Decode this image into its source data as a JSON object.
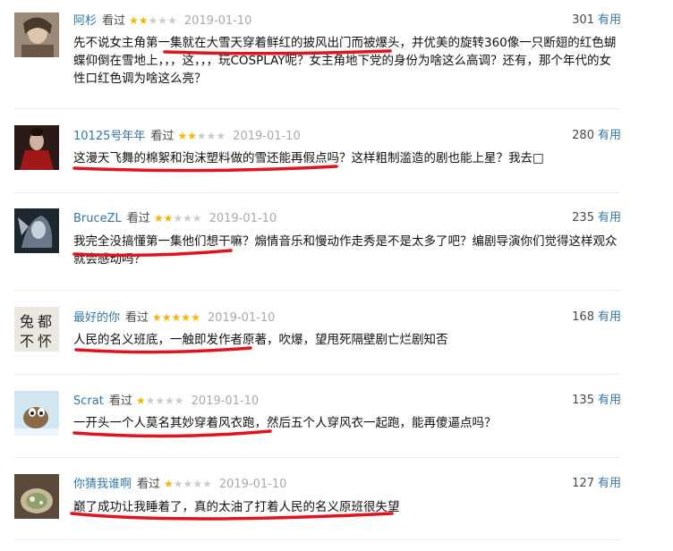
{
  "reviews": [
    {
      "user": "阿杉",
      "status": "看过",
      "rating": 2,
      "date": "2019-01-10",
      "votes": "301",
      "useful": "有用",
      "text": "先不说女主角第一集就在大雪天穿着鲜红的披风出门而被爆头，并优美的旋转360像一只断翅的红色蝴蝶仰倒在雪地上，，，这，，，玩COSPLAY呢？女主角地下党的身份为啥这么高调？还有，那个年代的女性口红色调为啥这么亮？",
      "avatar": {
        "bg": "#8c7a6a",
        "fg": "#d8c2a8",
        "accent": "#3a2e26"
      }
    },
    {
      "user": "10125号年年",
      "status": "看过",
      "rating": 2,
      "date": "2019-01-10",
      "votes": "280",
      "useful": "有用",
      "text": "这漫天飞舞的棉絮和泡沫塑料做的雪还能再假点吗？这样粗制滥造的剧也能上星？我去□",
      "avatar": {
        "bg": "#2b1a16",
        "fg": "#c8a898",
        "accent": "#a01818"
      }
    },
    {
      "user": "BruceZL",
      "status": "看过",
      "rating": 2,
      "date": "2019-01-10",
      "votes": "235",
      "useful": "有用",
      "text": "我完全没搞懂第一集他们想干嘛？煽情音乐和慢动作走秀是不是太多了吧？编剧导演你们觉得这样观众就会感动吗？",
      "avatar": {
        "bg": "#1e2630",
        "fg": "#8a97a8",
        "accent": "#d0d6de"
      }
    },
    {
      "user": "最好的你",
      "status": "看过",
      "rating": 5,
      "date": "2019-01-10",
      "votes": "168",
      "useful": "有用",
      "text": "人民的名义班底，一触即发作者原著，吹爆，望甩死隔壁剧亡烂剧知否",
      "avatar": {
        "bg": "#e8e4de",
        "fg": "#222222",
        "accent": "#666666",
        "glyphs": "兔都不怀"
      }
    },
    {
      "user": "Scrat",
      "status": "看过",
      "rating": 1,
      "date": "2019-01-10",
      "votes": "135",
      "useful": "有用",
      "text": "一开头一个人莫名其妙穿着风衣跑，然后五个人穿风衣一起跑，能再傻逼点吗？",
      "avatar": {
        "bg": "#cfe3f0",
        "fg": "#8a6a48",
        "accent": "#ffffff"
      }
    },
    {
      "user": "你猜我谁啊",
      "status": "看过",
      "rating": 1,
      "date": "2019-01-10",
      "votes": "127",
      "useful": "有用",
      "text": "巅了成功让我睡着了，真的太油了打着人民的名义原班很失望",
      "avatar": {
        "bg": "#5a4a3a",
        "fg": "#c8b89a",
        "accent": "#8ea070"
      }
    }
  ],
  "colors": {
    "link": "#37a",
    "star": "#f7b500",
    "annotation": "#e0141e"
  }
}
